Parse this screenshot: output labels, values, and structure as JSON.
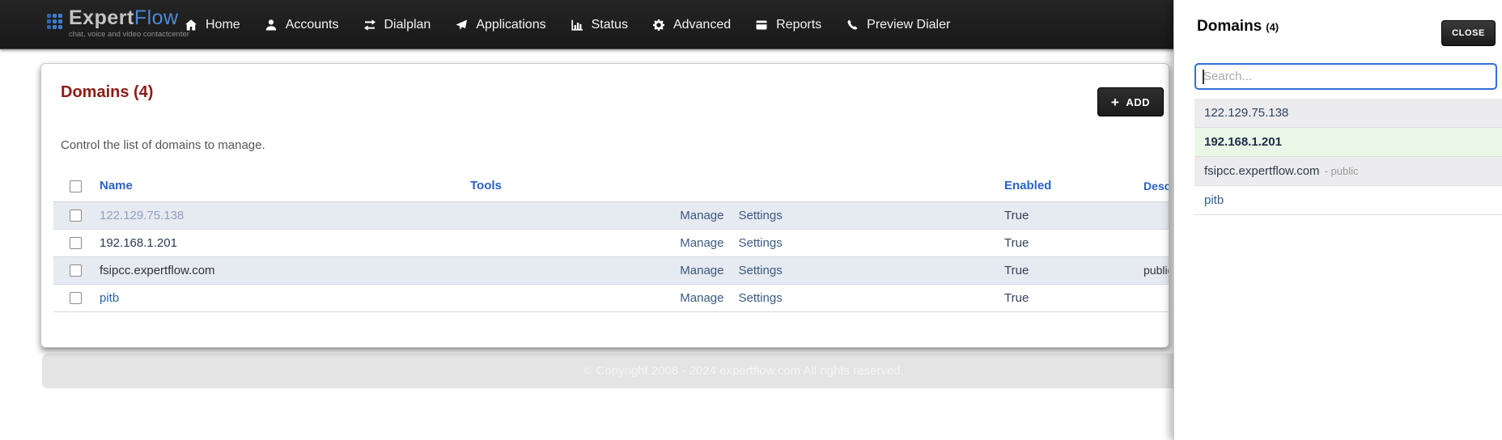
{
  "navbar": {
    "logo": {
      "expert": "Expert",
      "flow": "Flow",
      "tagline": "chat, voice and video contactcenter"
    },
    "items": [
      {
        "label": "Home",
        "icon": "home-icon"
      },
      {
        "label": "Accounts",
        "icon": "person-icon"
      },
      {
        "label": "Dialplan",
        "icon": "swap-arrows-icon"
      },
      {
        "label": "Applications",
        "icon": "paper-plane-icon"
      },
      {
        "label": "Status",
        "icon": "bar-chart-icon"
      },
      {
        "label": "Advanced",
        "icon": "gear-icon"
      },
      {
        "label": "Reports",
        "icon": "report-book-icon"
      },
      {
        "label": "Preview Dialer",
        "icon": "phone-icon"
      }
    ]
  },
  "main": {
    "title": "Domains (4)",
    "subtitle": "Control the list of domains to manage.",
    "add_button": "ADD",
    "add_plus_icon": "+",
    "table": {
      "headers": [
        "Name",
        "Tools",
        "Enabled",
        "Description"
      ],
      "rows": [
        {
          "name": "122.129.75.138",
          "tools": [
            "Manage",
            "Settings"
          ],
          "enabled": "True",
          "description": ""
        },
        {
          "name": "192.168.1.201",
          "tools": [
            "Manage",
            "Settings"
          ],
          "enabled": "True",
          "description": ""
        },
        {
          "name": "fsipcc.expertflow.com",
          "tools": [
            "Manage",
            "Settings"
          ],
          "enabled": "True",
          "description": "public"
        },
        {
          "name": "pitb",
          "tools": [
            "Manage",
            "Settings"
          ],
          "enabled": "True",
          "description": ""
        }
      ]
    },
    "footer": "© Copyright 2008 - 2024 expertflow.com All rights reserved."
  },
  "panel": {
    "title": "Domains",
    "count": "(4)",
    "close_button": "CLOSE",
    "search_placeholder": "Search...",
    "items": [
      {
        "label": "122.129.75.138",
        "suffix": "",
        "highlight": "gray"
      },
      {
        "label": "192.168.1.201",
        "suffix": "",
        "highlight": "green"
      },
      {
        "label": "fsipcc.expertflow.com",
        "suffix": "- public",
        "highlight": "gray"
      },
      {
        "label": "pitb",
        "suffix": "",
        "highlight": "white"
      }
    ]
  },
  "colors": {
    "brand_blue": "#4b8bd4",
    "navbar_bg": "#1f1f1f",
    "title_red": "#8b1d15",
    "table_header_blue": "#2b63c6",
    "row_stripe": "#e6eaf1",
    "dark_button_bg": "#222222",
    "search_focus_border": "#2e6fd8",
    "selected_item_green": "#e9f8e6"
  }
}
